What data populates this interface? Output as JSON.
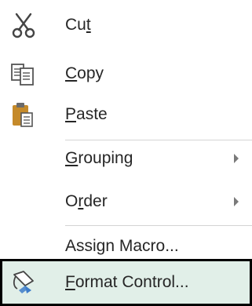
{
  "menu": {
    "items": [
      {
        "pre": "Cu",
        "ul": "t",
        "post": "",
        "icon": "scissors-icon",
        "submenu": false
      },
      {
        "pre": "",
        "ul": "C",
        "post": "opy",
        "icon": "copy-icon",
        "submenu": false
      },
      {
        "pre": "",
        "ul": "P",
        "post": "aste",
        "icon": "paste-icon",
        "submenu": false
      },
      {
        "pre": "",
        "ul": "G",
        "post": "rouping",
        "icon": "",
        "submenu": true
      },
      {
        "pre": "O",
        "ul": "r",
        "post": "der",
        "icon": "",
        "submenu": true
      },
      {
        "pre": "Assign Macro...",
        "ul": "",
        "post": "",
        "icon": "",
        "submenu": false
      },
      {
        "pre": "",
        "ul": "F",
        "post": "ormat Control...",
        "icon": "format-control-icon",
        "submenu": false,
        "selected": true
      }
    ]
  },
  "colors": {
    "text": "#262626",
    "highlight": "#e1efe8",
    "highlight_border": "#000000",
    "separator": "#d4d4d4",
    "scissors": "#444444",
    "paste_clipboard": "#c58a2a",
    "format_blue": "#3d7cc9"
  }
}
